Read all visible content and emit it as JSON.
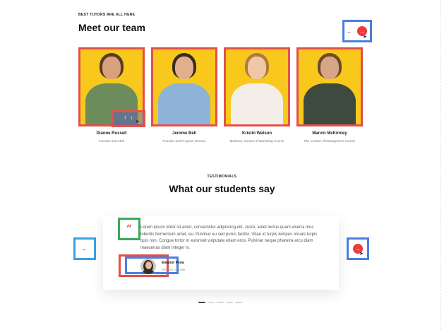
{
  "team": {
    "eyebrow": "BEST TUTORS ARE ALL HERE",
    "title": "Meet our team",
    "nav": {
      "prev_icon": "←",
      "next_icon": "→"
    },
    "members": [
      {
        "name": "Dianne Russell",
        "role": "Founder and CEO",
        "hair": "#5b3a24",
        "skin": "#d8a27e",
        "shirt": "#6d8c5c"
      },
      {
        "name": "Jerome Bell",
        "role": "Founder and Program Director",
        "hair": "#3b2b20",
        "skin": "#e0b08e",
        "shirt": "#8fb3d8"
      },
      {
        "name": "Kristin Watson",
        "role": "Marketer, Curator of Marketing Course",
        "hair": "#b07a3e",
        "skin": "#f0c8a8",
        "shirt": "#f3efe8"
      },
      {
        "name": "Marvin McKinney",
        "role": "PM, Curator of Management Course",
        "hair": "#6b4a2a",
        "skin": "#d6a684",
        "shirt": "#3f4a3e"
      }
    ]
  },
  "social": {
    "fb": "f",
    "tw": "t"
  },
  "testimonials": {
    "eyebrow": "TESTIMONIALS",
    "title": "What our students say",
    "prev_icon": "←",
    "next_icon": "→",
    "quote_mark": "“",
    "text": "Lorem ipsum dolor sit amet, consectetur adipiscing elit. Justo, amet lectus quam viverra mus lobortis fermentum amet, eu. Pulvinar eu sed purus facilisi. Vitae id turpis tempus ornare turpis quis non. Congue tortor in euismod vulputate etiam eros. Pulvinar neque pharetra arcu diam maecenas diam integer in.",
    "author": {
      "name": "Eleanor Pena",
      "role": "Position, Course"
    },
    "dots": 5,
    "active_dot": 0
  },
  "colors": {
    "accent_red": "#ef3b3b",
    "card_yellow": "#f8c81c"
  }
}
